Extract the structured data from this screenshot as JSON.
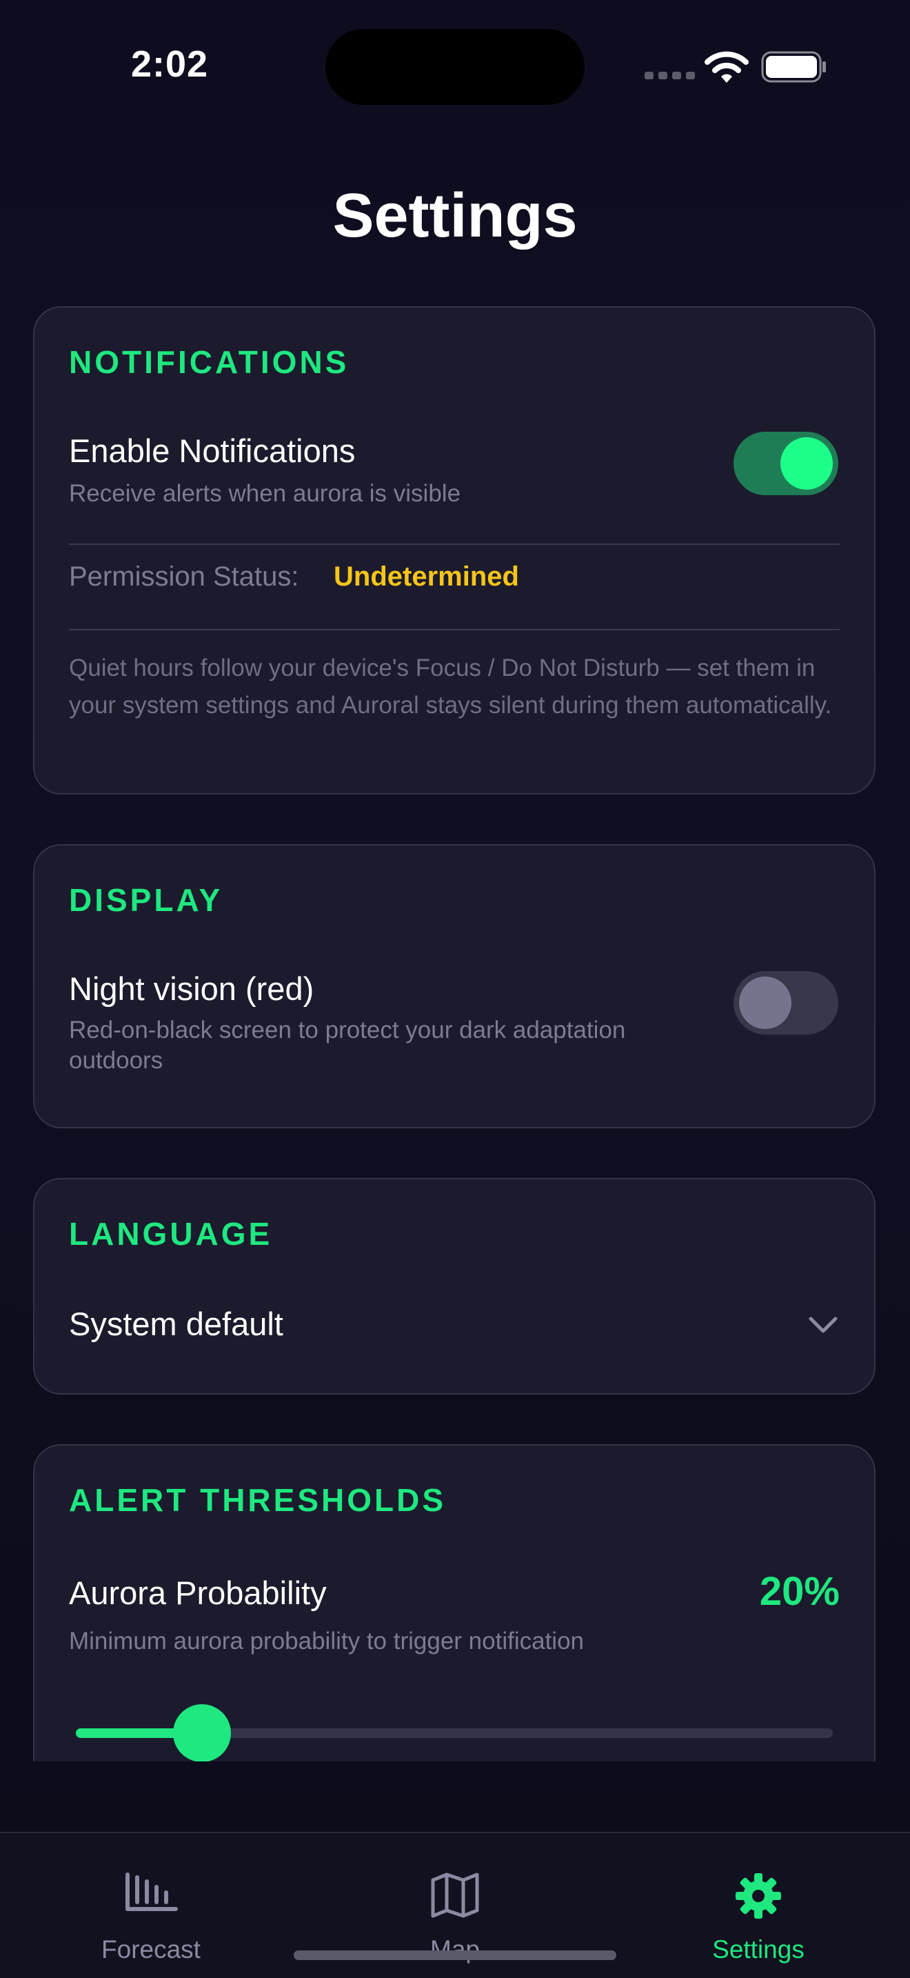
{
  "status_bar": {
    "time": "2:02"
  },
  "page_title": "Settings",
  "notifications": {
    "section_title": "NOTIFICATIONS",
    "enable_title": "Enable Notifications",
    "enable_subtitle": "Receive alerts when aurora is visible",
    "enabled": true,
    "permission_label": "Permission Status:",
    "permission_value": "Undetermined",
    "permission_color": "#f5c518",
    "quiet_hours_note": "Quiet hours follow your device's Focus / Do Not Disturb — set them in your system settings and Auroral stays silent during them automatically."
  },
  "display": {
    "section_title": "DISPLAY",
    "night_vision_title": "Night vision (red)",
    "night_vision_subtitle": "Red-on-black screen to protect your dark adaptation outdoors",
    "night_vision_enabled": false
  },
  "language": {
    "section_title": "LANGUAGE",
    "selected": "System default"
  },
  "alert_thresholds": {
    "section_title": "ALERT THRESHOLDS",
    "aurora_probability_title": "Aurora Probability",
    "aurora_probability_subtitle": "Minimum aurora probability to trigger notification",
    "aurora_probability_value": "20%",
    "slider_fraction": 0.167
  },
  "tabs": [
    {
      "label": "Forecast",
      "icon": "bar-chart-icon",
      "active": false
    },
    {
      "label": "Map",
      "icon": "map-icon",
      "active": false
    },
    {
      "label": "Settings",
      "icon": "gear-icon",
      "active": true
    }
  ],
  "colors": {
    "accent": "#1ee87f",
    "background": "#0d0d1f",
    "card": "#1b1b2d"
  }
}
